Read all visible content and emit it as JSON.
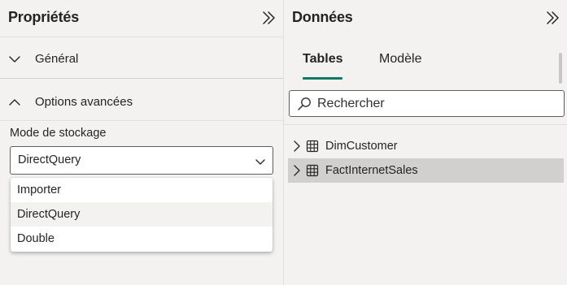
{
  "properties": {
    "title": "Propriétés",
    "sections": [
      {
        "label": "Général",
        "expanded": false
      },
      {
        "label": "Options avancées",
        "expanded": true
      }
    ],
    "storage_mode": {
      "label": "Mode de stockage",
      "value": "DirectQuery",
      "options": [
        "Importer",
        "DirectQuery",
        "Double"
      ]
    }
  },
  "data_pane": {
    "title": "Données",
    "tabs": [
      {
        "label": "Tables",
        "active": true
      },
      {
        "label": "Modèle",
        "active": false
      }
    ],
    "search_placeholder": "Rechercher",
    "tables": [
      {
        "name": "DimCustomer",
        "selected": false
      },
      {
        "name": "FactInternetSales",
        "selected": true
      }
    ]
  },
  "colors": {
    "accent": "#117865",
    "pane_background": "#f3f2f1",
    "selected_row": "#d2d0ce"
  },
  "icons": {
    "collapse": "double-chevron-right-icon",
    "section_collapsed": "chevron-down-icon",
    "section_expanded": "chevron-up-icon",
    "select": "chevron-down-icon",
    "search": "search-icon",
    "tree_expand": "chevron-right-icon",
    "table": "table-icon"
  }
}
